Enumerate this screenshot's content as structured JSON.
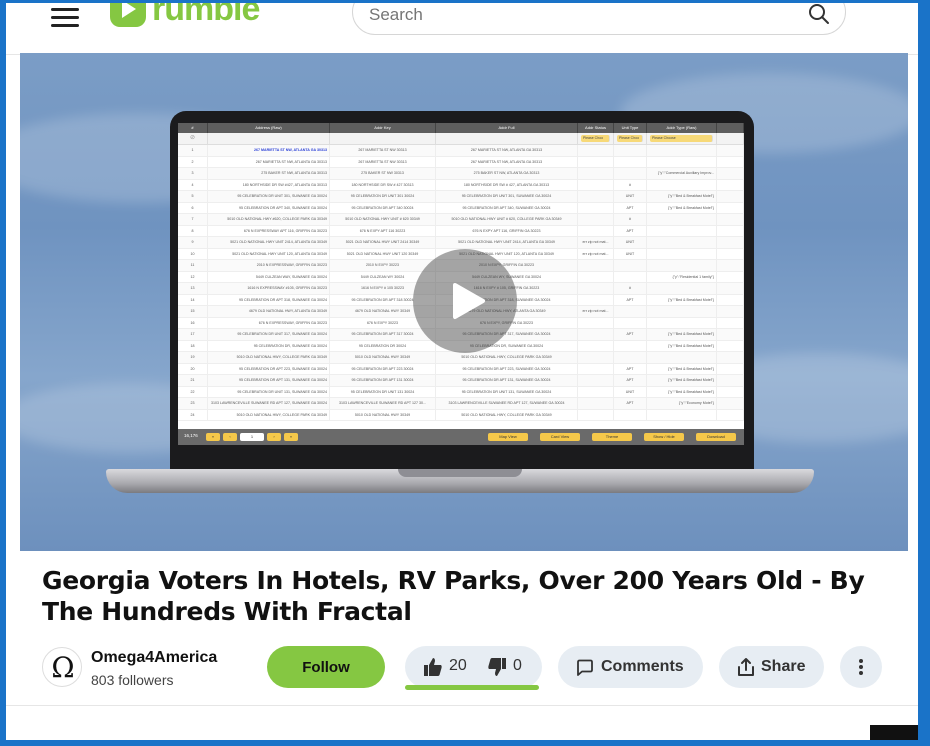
{
  "header": {
    "logo_text": "rumble",
    "search_placeholder": "Search"
  },
  "video": {
    "spreadsheet": {
      "headers": [
        "#",
        "Address (Raw)",
        "Addr Key",
        "Addr Full",
        "Addr Status",
        "Unit Type",
        "Addr Type (Raw)",
        ""
      ],
      "filter_placeholder": "Please Choo",
      "filter_placeholder_wide": "Please Choose",
      "rows": [
        [
          "1",
          "267 MARIETTA ST NW, ATLANTA GA 30313",
          "267 MARIETTA ST NW 30313",
          "267 MARIETTA ST NW, ATLANTA GA 30313",
          "",
          "",
          ""
        ],
        [
          "2",
          "267 MARIETTA ST NW, ATLANTA GA 30313",
          "267 MARIETTA ST NW 30313",
          "267 MARIETTA ST NW, ATLANTA GA 30313",
          "",
          "",
          ""
        ],
        [
          "3",
          "275 BAKER ST NW, ATLANTA GA 30313",
          "275 BAKER ST NW 30313",
          "275 BAKER ST NW, ATLANTA GA 30313",
          "",
          "",
          "{\"y\":\"Commercial Auxiliary Improv..."
        ],
        [
          "4",
          "180 NORTHSIDE DR SW #427, ATLANTA GA 30313",
          "180 NORTHSIDE DR SW # 427 30313",
          "180 NORTHSIDE DR SW # 427, ATLANTA GA 30313",
          "",
          "#",
          ""
        ],
        [
          "5",
          "95 CELEBRATION DR UNIT 301, SUWANEE GA 30024",
          "95 CELEBRATION DR UNIT 301 30024",
          "95 CELEBRATION DR UNIT 301, SUWANEE GA 30024",
          "",
          "UNIT",
          "{\"y\":\"Bed & Breakfast Motel\"}"
        ],
        [
          "6",
          "95 CELEBRATION DR APT 340, SUWANEE GA 30024",
          "95 CELEBRATION DR APT 340 30024",
          "95 CELEBRATION DR APT 340, SUWANEE GA 30024",
          "",
          "APT",
          "{\"y\":\"Bed & Breakfast Motel\"}"
        ],
        [
          "7",
          "5010 OLD NATIONAL HWY #620, COLLEGE PARK GA 30349",
          "5010 OLD NATIONAL HWY UNIT # 620 30349",
          "5010 OLD NATIONAL HWY UNIT # 620, COLLEGE PARK GA 30349",
          "",
          "#",
          ""
        ],
        [
          "8",
          "676 N EXPRESSWAY APT 116, GRIFFIN GA 30223",
          "676 N EXPY APT 116 30223",
          "676 N EXPY APT 116, GRIFFIN GA 30223",
          "",
          "APT",
          ""
        ],
        [
          "9",
          "5021 OLD NATIONAL HWY UNIT 2414, ATLANTA GA 30349",
          "5021 OLD NATIONAL HWY UNIT 2414 30349",
          "5021 OLD NATIONAL HWY UNIT 2414, ATLANTA GA 30349",
          "err zip not mat...",
          "UNIT",
          ""
        ],
        [
          "10",
          "5021 OLD NATIONAL HWY UNIT 120, ATLANTA GA 30349",
          "5021 OLD NATIONAL HWY UNIT 120 30349",
          "5021 OLD NATIONAL HWY UNIT 120, ATLANTA GA 30349",
          "err zip not mat...",
          "UNIT",
          ""
        ],
        [
          "11",
          "2010 N EXPRESSWAY, GRIFFIN GA 30223",
          "2010 N EXPY 30223",
          "2010 N EXPY, GRIFFIN GA 30223",
          "",
          "",
          ""
        ],
        [
          "12",
          "5449 CULZEAN WAY, SUWANEE GA 30024",
          "5449 CULZEAN WY 30024",
          "5449 CULZEAN WY, SUWANEE GA 30024",
          "",
          "",
          "{\"y\":\"Residential 1 family\"}"
        ],
        [
          "13",
          "1616 N EXPRESSWAY #105, GRIFFIN GA 30223",
          "1616 N EXPY # 105 30223",
          "1616 N EXPY # 105, GRIFFIN GA 30223",
          "",
          "#",
          ""
        ],
        [
          "14",
          "95 CELEBRATION DR APT 318, SUWANEE GA 30024",
          "95 CELEBRATION DR APT 318 30024",
          "95 CELEBRATION DR APT 318, SUWANEE GA 30024",
          "",
          "APT",
          "{\"y\":\"Bed & Breakfast Motel\"}"
        ],
        [
          "15",
          "4679 OLD NATIONAL HWY, ATLANTA GA 30349",
          "4679 OLD NATIONAL HWY 30349",
          "4679 OLD NATIONAL HWY, ATLANTA GA 30349",
          "err zip not mat...",
          "",
          ""
        ],
        [
          "16",
          "676 N EXPRESSWAY, GRIFFIN GA 30223",
          "676 N EXPY 30223",
          "676 N EXPY, GRIFFIN GA 30223",
          "",
          "",
          ""
        ],
        [
          "17",
          "95 CELEBRATION DR UNIT 317, SUWANEE GA 30024",
          "95 CELEBRATION DR APT 317 30024",
          "95 CELEBRATION DR APT 317, SUWANEE GA 30024",
          "",
          "APT",
          "{\"y\":\"Bed & Breakfast Motel\"}"
        ],
        [
          "18",
          "95 CELEBRATION DR, SUWANEE GA 30024",
          "95 CELEBRATION DR 30024",
          "95 CELEBRATION DR, SUWANEE GA 30024",
          "",
          "",
          "{\"y\":\"Bed & Breakfast Motel\"}"
        ],
        [
          "19",
          "5010 OLD NATIONAL HWY, COLLEGE PARK GA 30349",
          "5010 OLD NATIONAL HWY 30349",
          "5010 OLD NATIONAL HWY, COLLEGE PARK GA 30349",
          "",
          "",
          ""
        ],
        [
          "20",
          "95 CELEBRATION DR APT 223, SUWANEE GA 30024",
          "95 CELEBRATION DR APT 223 30024",
          "95 CELEBRATION DR APT 223, SUWANEE GA 30024",
          "",
          "APT",
          "{\"y\":\"Bed & Breakfast Motel\"}"
        ],
        [
          "21",
          "95 CELEBRATION DR APT 131, SUWANEE GA 30024",
          "95 CELEBRATION DR APT 131 30024",
          "95 CELEBRATION DR APT 131, SUWANEE GA 30024",
          "",
          "APT",
          "{\"y\":\"Bed & Breakfast Motel\"}"
        ],
        [
          "22",
          "95 CELEBRATION DR UNIT 131, SUWANEE GA 30024",
          "95 CELEBRATION DR UNIT 131 30024",
          "95 CELEBRATION DR UNIT 131, SUWANEE GA 30024",
          "",
          "UNIT",
          "{\"y\":\"Bed & Breakfast Motel\"}"
        ],
        [
          "23",
          "3103 LAWRENCEVILLE SUWANEE RD APT 127, SUWANEE GA 30024",
          "3103 LAWRENCEVILLE SUWANEE RD APT 127 30...",
          "3103 LAWRENCEVILLE SUWANEE RD APT 127, SUWANEE GA 30024",
          "",
          "APT",
          "{\"y\":\"Economy Motel\"}"
        ],
        [
          "24",
          "5010 OLD NATIONAL HWY, COLLEGE PARK GA 30349",
          "5010 OLD NATIONAL HWY 30349",
          "5010 OLD NATIONAL HWY, COLLEGE PARK GA 30349",
          "",
          "",
          ""
        ]
      ],
      "footer": {
        "count": "16,176",
        "page": "1",
        "buttons": [
          "Map View",
          "Card View",
          "Theme",
          "Show / Hide",
          "Download"
        ]
      }
    }
  },
  "title": "Georgia Voters In Hotels, RV Parks, Over 200 Years Old - By The Hundreds With Fractal",
  "channel": {
    "name": "Omega4America",
    "followers": "803 followers",
    "follow_label": "Follow"
  },
  "actions": {
    "likes": "20",
    "dislikes": "0",
    "like_ratio": 1.0,
    "comments_label": "Comments",
    "share_label": "Share"
  },
  "colors": {
    "accent": "#85c742",
    "frame": "#1a73c8",
    "pill_bg": "#e7edf3"
  }
}
